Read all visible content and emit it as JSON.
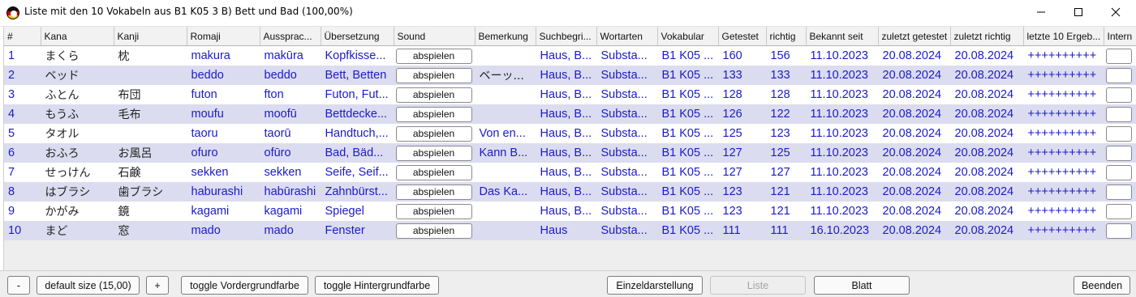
{
  "window": {
    "title": "Liste mit den 10 Vokabeln aus B1 K05 3 B) Bett und Bad (100,00%)",
    "icon": "japan-flag-icon",
    "minimize_glyph": "—",
    "close_glyph": "✕"
  },
  "table": {
    "columns": [
      "#",
      "Kana",
      "Kanji",
      "Romaji",
      "Aussprac...",
      "Übersetzung",
      "Sound",
      "Bemerkung",
      "Suchbegri...",
      "Wortarten",
      "Vokabular",
      "Getestet",
      "richtig",
      "Bekannt seit",
      "zuletzt getestet",
      "zuletzt richtig",
      "letzte 10 Ergeb...",
      "Intern"
    ],
    "play_label": "abspielen",
    "rows": [
      {
        "num": "1",
        "kana": "まくら",
        "kanji": "枕",
        "romaji": "makura",
        "aussprache": "makūra",
        "uebersetzung": "Kopfkisse...",
        "bemerkung": "",
        "suchbegriffe": "Haus, B...",
        "wortarten": "Substa...",
        "vokabular": "B1 K05 ...",
        "getestet": "160",
        "richtig": "156",
        "bekannt": "11.10.2023",
        "zuletzt_getestet": "20.08.2024",
        "zuletzt_richtig": "20.08.2024",
        "letzte10": "++++++++++"
      },
      {
        "num": "2",
        "kana": "ベッド",
        "kanji": "",
        "romaji": "beddo",
        "aussprache": "beddo",
        "uebersetzung": "Bett, Betten",
        "bemerkung": "ベーッ...",
        "suchbegriffe": "Haus, B...",
        "wortarten": "Substa...",
        "vokabular": "B1 K05 ...",
        "getestet": "133",
        "richtig": "133",
        "bekannt": "11.10.2023",
        "zuletzt_getestet": "20.08.2024",
        "zuletzt_richtig": "20.08.2024",
        "letzte10": "++++++++++"
      },
      {
        "num": "3",
        "kana": "ふとん",
        "kanji": "布団",
        "romaji": "futon",
        "aussprache": "fton",
        "uebersetzung": "Futon, Fut...",
        "bemerkung": "",
        "suchbegriffe": "Haus, B...",
        "wortarten": "Substa...",
        "vokabular": "B1 K05 ...",
        "getestet": "128",
        "richtig": "128",
        "bekannt": "11.10.2023",
        "zuletzt_getestet": "20.08.2024",
        "zuletzt_richtig": "20.08.2024",
        "letzte10": "++++++++++"
      },
      {
        "num": "4",
        "kana": "もうふ",
        "kanji": "毛布",
        "romaji": "moufu",
        "aussprache": "moofū",
        "uebersetzung": "Bettdecke...",
        "bemerkung": "",
        "suchbegriffe": "Haus, B...",
        "wortarten": "Substa...",
        "vokabular": "B1 K05 ...",
        "getestet": "126",
        "richtig": "122",
        "bekannt": "11.10.2023",
        "zuletzt_getestet": "20.08.2024",
        "zuletzt_richtig": "20.08.2024",
        "letzte10": "++++++++++"
      },
      {
        "num": "5",
        "kana": "タオル",
        "kanji": "",
        "romaji": "taoru",
        "aussprache": "taorū",
        "uebersetzung": "Handtuch,...",
        "bemerkung": "Von en...",
        "suchbegriffe": "Haus, B...",
        "wortarten": "Substa...",
        "vokabular": "B1 K05 ...",
        "getestet": "125",
        "richtig": "123",
        "bekannt": "11.10.2023",
        "zuletzt_getestet": "20.08.2024",
        "zuletzt_richtig": "20.08.2024",
        "letzte10": "++++++++++"
      },
      {
        "num": "6",
        "kana": "おふろ",
        "kanji": "お風呂",
        "romaji": "ofuro",
        "aussprache": "ofūro",
        "uebersetzung": "Bad, Bäd...",
        "bemerkung": "Kann B...",
        "suchbegriffe": "Haus, B...",
        "wortarten": "Substa...",
        "vokabular": "B1 K05 ...",
        "getestet": "127",
        "richtig": "125",
        "bekannt": "11.10.2023",
        "zuletzt_getestet": "20.08.2024",
        "zuletzt_richtig": "20.08.2024",
        "letzte10": "++++++++++"
      },
      {
        "num": "7",
        "kana": "せっけん",
        "kanji": "石鹸",
        "romaji": "sekken",
        "aussprache": "sekken",
        "uebersetzung": "Seife, Seif...",
        "bemerkung": "",
        "suchbegriffe": "Haus, B...",
        "wortarten": "Substa...",
        "vokabular": "B1 K05 ...",
        "getestet": "127",
        "richtig": "127",
        "bekannt": "11.10.2023",
        "zuletzt_getestet": "20.08.2024",
        "zuletzt_richtig": "20.08.2024",
        "letzte10": "++++++++++"
      },
      {
        "num": "8",
        "kana": "はブラシ",
        "kanji": "歯ブラシ",
        "romaji": "haburashi",
        "aussprache": "habūrashi",
        "uebersetzung": "Zahnbürst...",
        "bemerkung": "Das Ka...",
        "suchbegriffe": "Haus, B...",
        "wortarten": "Substa...",
        "vokabular": "B1 K05 ...",
        "getestet": "123",
        "richtig": "121",
        "bekannt": "11.10.2023",
        "zuletzt_getestet": "20.08.2024",
        "zuletzt_richtig": "20.08.2024",
        "letzte10": "++++++++++"
      },
      {
        "num": "9",
        "kana": "かがみ",
        "kanji": "鏡",
        "romaji": "kagami",
        "aussprache": "kagami",
        "uebersetzung": "Spiegel",
        "bemerkung": "",
        "suchbegriffe": "Haus, B...",
        "wortarten": "Substa...",
        "vokabular": "B1 K05 ...",
        "getestet": "123",
        "richtig": "121",
        "bekannt": "11.10.2023",
        "zuletzt_getestet": "20.08.2024",
        "zuletzt_richtig": "20.08.2024",
        "letzte10": "++++++++++"
      },
      {
        "num": "10",
        "kana": "まど",
        "kanji": "窓",
        "romaji": "mado",
        "aussprache": "mado",
        "uebersetzung": "Fenster",
        "bemerkung": "",
        "suchbegriffe": "Haus",
        "wortarten": "Substa...",
        "vokabular": "B1 K05 ...",
        "getestet": "111",
        "richtig": "111",
        "bekannt": "16.10.2023",
        "zuletzt_getestet": "20.08.2024",
        "zuletzt_richtig": "20.08.2024",
        "letzte10": "++++++++++"
      }
    ]
  },
  "toolbar": {
    "minus_label": "-",
    "default_size_label": "default size (15,00)",
    "plus_label": "+",
    "toggle_fg_label": "toggle Vordergrundfarbe",
    "toggle_bg_label": "toggle Hintergrundfarbe",
    "einzel_label": "Einzeldarstellung",
    "liste_label": "Liste",
    "blatt_label": "Blatt",
    "beenden_label": "Beenden"
  },
  "colors": {
    "cell_text": "#1a1acc",
    "row_alt": "#dcdcf0",
    "row": "#ffffff"
  }
}
